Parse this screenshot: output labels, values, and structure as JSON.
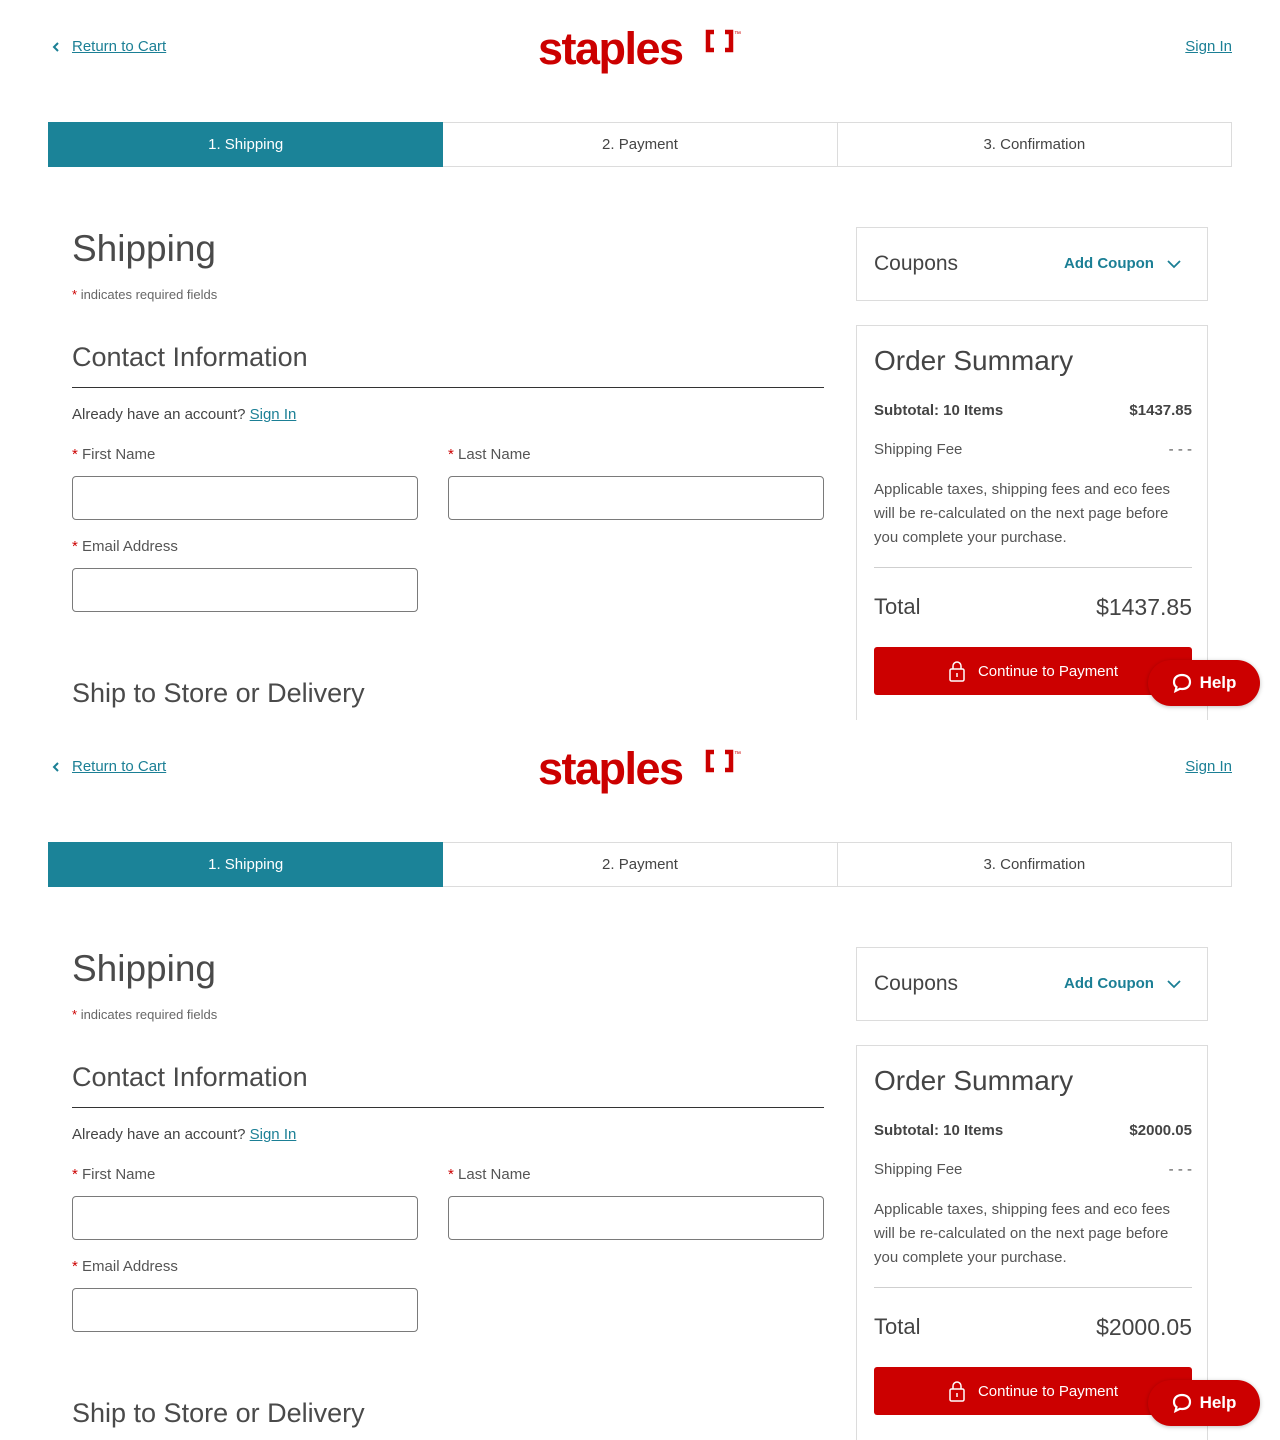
{
  "colors": {
    "accent": "#1b8398",
    "brand_red": "#cc0000",
    "link": "#1b7f95"
  },
  "header": {
    "back_label": "Return to Cart",
    "logo_text": "staples",
    "logo_tm": "™",
    "sign_in_label": "Sign In"
  },
  "steps": [
    {
      "label": "1. Shipping",
      "active": true
    },
    {
      "label": "2. Payment",
      "active": false
    },
    {
      "label": "3. Confirmation",
      "active": false
    }
  ],
  "form": {
    "title": "Shipping",
    "required_star": "*",
    "required_note": "indicates required fields",
    "contact_title": "Contact Information",
    "account_prompt": "Already have an account?",
    "account_sign_in": "Sign In",
    "first_name_label": "First Name",
    "first_name_value": "",
    "last_name_label": "Last Name",
    "last_name_value": "",
    "email_label": "Email Address",
    "email_value": "",
    "ship_title": "Ship to Store or Delivery"
  },
  "coupons": {
    "label": "Coupons",
    "add_label": "Add Coupon"
  },
  "views": [
    {
      "summary": {
        "title": "Order Summary",
        "subtotal_label": "Subtotal: 10 Items",
        "subtotal_value": "$1437.85",
        "shipping_label": "Shipping Fee",
        "shipping_value": "- - -",
        "tax_note": "Applicable taxes, shipping fees and eco fees will be re-calculated on the next page before you complete your purchase.",
        "total_label": "Total",
        "total_value": "$1437.85",
        "continue_label": "Continue to Payment"
      }
    },
    {
      "summary": {
        "title": "Order Summary",
        "subtotal_label": "Subtotal: 10 Items",
        "subtotal_value": "$2000.05",
        "shipping_label": "Shipping Fee",
        "shipping_value": "- - -",
        "tax_note": "Applicable taxes, shipping fees and eco fees will be re-calculated on the next page before you complete your purchase.",
        "total_label": "Total",
        "total_value": "$2000.05",
        "continue_label": "Continue to Payment"
      }
    }
  ],
  "help": {
    "label": "Help",
    "icon": "chat-bubble-icon"
  }
}
